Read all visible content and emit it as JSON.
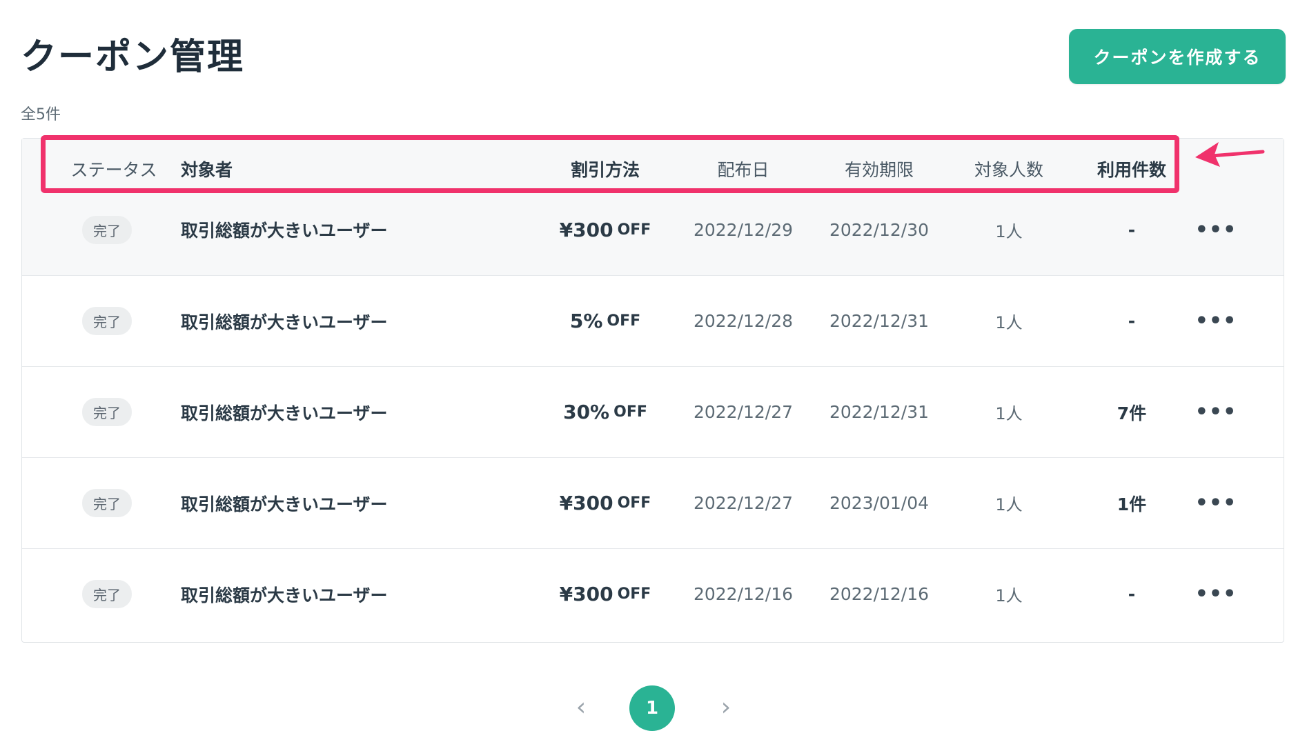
{
  "header": {
    "title": "クーポン管理",
    "create_button": "クーポンを作成する",
    "total": "全5件"
  },
  "table": {
    "columns": {
      "status": "ステータス",
      "target": "対象者",
      "discount": "割引方法",
      "distribution_date": "配布日",
      "expiry": "有効期限",
      "people": "対象人数",
      "usage": "利用件数"
    },
    "rows": [
      {
        "status": "完了",
        "target": "取引総額が大きいユーザー",
        "discount_value": "¥300",
        "discount_suffix": "OFF",
        "distribution_date": "2022/12/29",
        "expiry": "2022/12/30",
        "people": "1人",
        "usage": "-"
      },
      {
        "status": "完了",
        "target": "取引総額が大きいユーザー",
        "discount_value": "5%",
        "discount_suffix": "OFF",
        "distribution_date": "2022/12/28",
        "expiry": "2022/12/31",
        "people": "1人",
        "usage": "-"
      },
      {
        "status": "完了",
        "target": "取引総額が大きいユーザー",
        "discount_value": "30%",
        "discount_suffix": "OFF",
        "distribution_date": "2022/12/27",
        "expiry": "2022/12/31",
        "people": "1人",
        "usage": "7件"
      },
      {
        "status": "完了",
        "target": "取引総額が大きいユーザー",
        "discount_value": "¥300",
        "discount_suffix": "OFF",
        "distribution_date": "2022/12/27",
        "expiry": "2023/01/04",
        "people": "1人",
        "usage": "1件"
      },
      {
        "status": "完了",
        "target": "取引総額が大きいユーザー",
        "discount_value": "¥300",
        "discount_suffix": "OFF",
        "distribution_date": "2022/12/16",
        "expiry": "2022/12/16",
        "people": "1人",
        "usage": "-"
      }
    ]
  },
  "pagination": {
    "current_page": "1",
    "prev_icon": "chevron-left-icon",
    "next_icon": "chevron-right-icon"
  },
  "colors": {
    "accent": "#2ab394",
    "annotation": "#f0326c"
  }
}
